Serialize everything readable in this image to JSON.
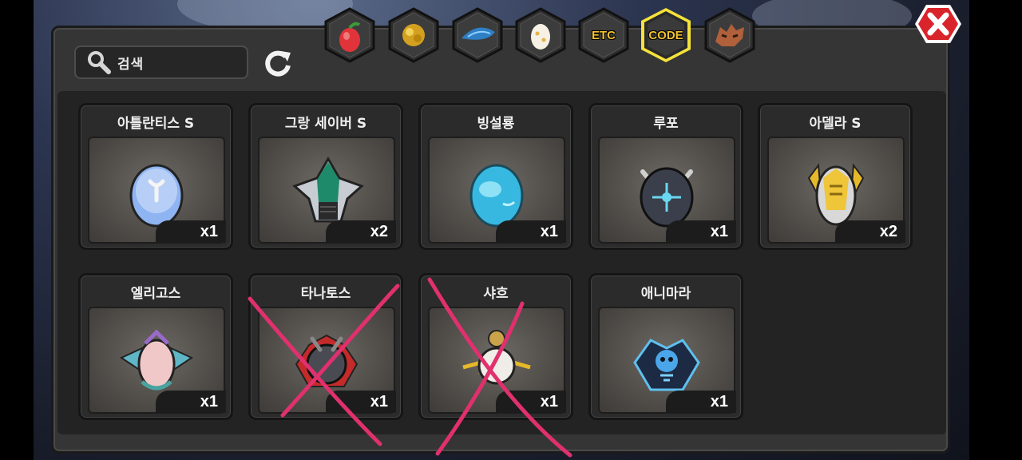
{
  "search": {
    "placeholder": "검색"
  },
  "tabs": [
    {
      "name": "fruit",
      "icon": "fruit-icon"
    },
    {
      "name": "gold",
      "icon": "gold-ore-icon"
    },
    {
      "name": "scale",
      "icon": "blue-scale-icon"
    },
    {
      "name": "egg",
      "icon": "egg-icon"
    },
    {
      "name": "etc",
      "label": "ETC"
    },
    {
      "name": "code",
      "label": "CODE",
      "selected": true
    },
    {
      "name": "dragon",
      "icon": "dragon-head-icon"
    }
  ],
  "items": [
    {
      "name": "아틀란티스 S",
      "qty": "x1",
      "icon": "blue-egg-icon"
    },
    {
      "name": "그랑 세이버 S",
      "qty": "x2",
      "icon": "green-helmet-icon"
    },
    {
      "name": "빙설룡",
      "qty": "x1",
      "icon": "ice-egg-icon"
    },
    {
      "name": "루포",
      "qty": "x1",
      "icon": "dark-horned-egg-icon"
    },
    {
      "name": "아델라 S",
      "qty": "x2",
      "icon": "gold-armor-egg-icon"
    },
    {
      "name": "엘리고스",
      "qty": "x1",
      "icon": "winged-crest-icon"
    },
    {
      "name": "타나토스",
      "qty": "x1",
      "icon": "dark-spiked-crest-icon",
      "crossed_out": true
    },
    {
      "name": "샤흐",
      "qty": "x1",
      "icon": "gold-lightning-orb-icon",
      "crossed_out": true
    },
    {
      "name": "애니마라",
      "qty": "x1",
      "icon": "spirit-crest-icon"
    }
  ],
  "colors": {
    "tab_selected_border": "#f5e23a",
    "tab_label": "#f2c230",
    "close_button": "#d9242b",
    "cross_mark": "#e0306e"
  }
}
